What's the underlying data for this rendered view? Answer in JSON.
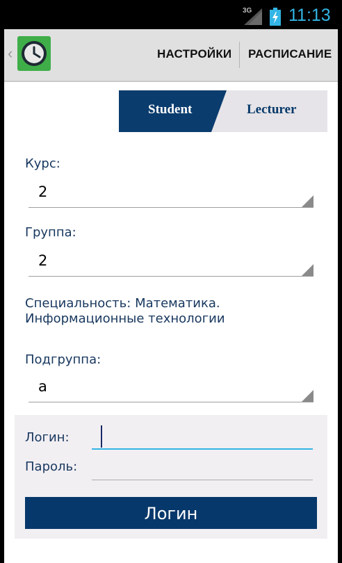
{
  "status_bar": {
    "network": "3G",
    "time": "11:13",
    "time_color": "#33b5e5",
    "icons": [
      "signal-icon",
      "battery-charging-icon"
    ]
  },
  "action_bar": {
    "up_icon": "chevron-left-icon",
    "app_icon": "clock-icon",
    "items": [
      "НАСТРОЙКИ",
      "РАСПИСАНИЕ"
    ],
    "background": "#e0e0e0"
  },
  "role_toggle": {
    "student": "Student",
    "lecturer": "Lecturer",
    "selected": "Student",
    "active_color": "#0a3c6e",
    "inactive_color": "#e6e4e8"
  },
  "form": {
    "course_label": "Курс:",
    "course_value": "2",
    "group_label": "Группа:",
    "group_value": "2",
    "specialty_line1": "Специальность: Математика.",
    "specialty_line2": "Информационные технологии",
    "subgroup_label": "Подгруппа:",
    "subgroup_value": "a"
  },
  "login": {
    "login_label": "Логин:",
    "login_value": "",
    "password_label": "Пароль:",
    "password_value": "",
    "button_label": "Логин",
    "button_color": "#07386b",
    "panel_color": "#f2eff3"
  }
}
